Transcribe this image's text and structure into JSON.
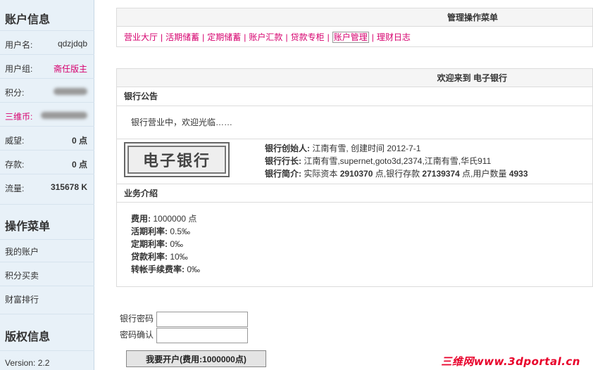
{
  "sidebar": {
    "account_title": "账户信息",
    "fields": [
      {
        "label": "用户名:",
        "value": "qdzjdqb"
      },
      {
        "label": "用户组:",
        "value": "斋任版主"
      },
      {
        "label": "积分:",
        "value": ""
      },
      {
        "label": "三维币:",
        "value": ""
      },
      {
        "label": "威望:",
        "value": "0 点"
      },
      {
        "label": "存款:",
        "value": "0 点"
      },
      {
        "label": "流量:",
        "value": "315678 K"
      }
    ],
    "menu_title": "操作菜单",
    "menu": [
      "我的账户",
      "积分买卖",
      "财富排行"
    ],
    "copyright_title": "版权信息",
    "version": "Version: 2.2"
  },
  "menu_panel": {
    "title": "管理操作菜单",
    "items": [
      "营业大厅",
      "活期储蓄",
      "定期储蓄",
      "账户汇款",
      "贷款专柜",
      "账户管理",
      "理财日志"
    ],
    "active": "账户管理"
  },
  "welcome_panel": {
    "title": "欢迎来到 电子银行",
    "notice_title": "银行公告",
    "notice_text": "银行营业中，欢迎光临……",
    "logo_text": "电子银行",
    "founder_label": "银行创始人:",
    "founder_value": "江南有雪, 创建时间 2012-7-1",
    "president_label": "银行行长:",
    "president_value": "江南有雪,supernet,goto3d,2374,江南有雪,华氏911",
    "intro_label": "银行简介:",
    "intro_capital_prefix": "实际资本 ",
    "intro_capital": "2910370",
    "intro_deposit_prefix": " 点,银行存款 ",
    "intro_deposit": "27139374",
    "intro_users_prefix": " 点,用户数量 ",
    "intro_users": "4933",
    "business_title": "业务介绍",
    "business": [
      {
        "label": "费用:",
        "value": "1000000 点"
      },
      {
        "label": "活期利率:",
        "value": "0.5‰"
      },
      {
        "label": "定期利率:",
        "value": "0‰"
      },
      {
        "label": "贷款利率:",
        "value": "10‰"
      },
      {
        "label": "转帐手续费率:",
        "value": "0‰"
      }
    ]
  },
  "form": {
    "password_label": "银行密码",
    "confirm_label": "密码确认",
    "submit_label": "我要开户(费用:1000000点)"
  },
  "watermark": "三维网www.3dportal.cn"
}
